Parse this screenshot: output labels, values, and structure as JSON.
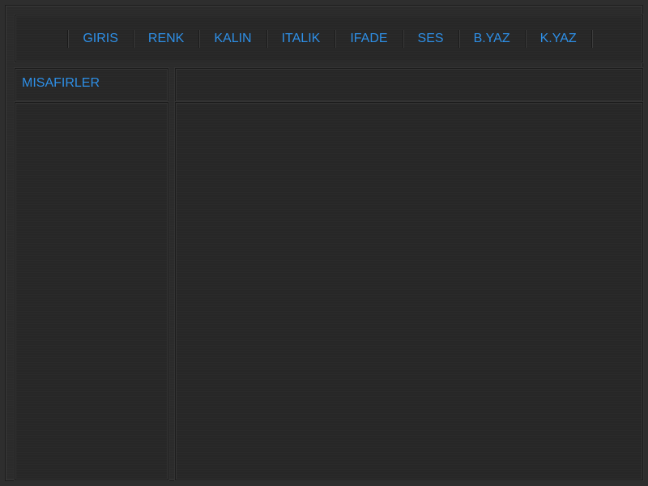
{
  "menu": {
    "items": [
      {
        "label": "GIRIS"
      },
      {
        "label": "RENK"
      },
      {
        "label": "KALIN"
      },
      {
        "label": "ITALIK"
      },
      {
        "label": "IFADE"
      },
      {
        "label": "SES"
      },
      {
        "label": "B.YAZ"
      },
      {
        "label": "K.YAZ"
      }
    ]
  },
  "sidebar": {
    "title": "MISAFIRLER",
    "guests": []
  },
  "main": {
    "messages": []
  },
  "colors": {
    "accent": "#2e8fe6",
    "background": "#2b2b2b",
    "panel": "#272727"
  }
}
